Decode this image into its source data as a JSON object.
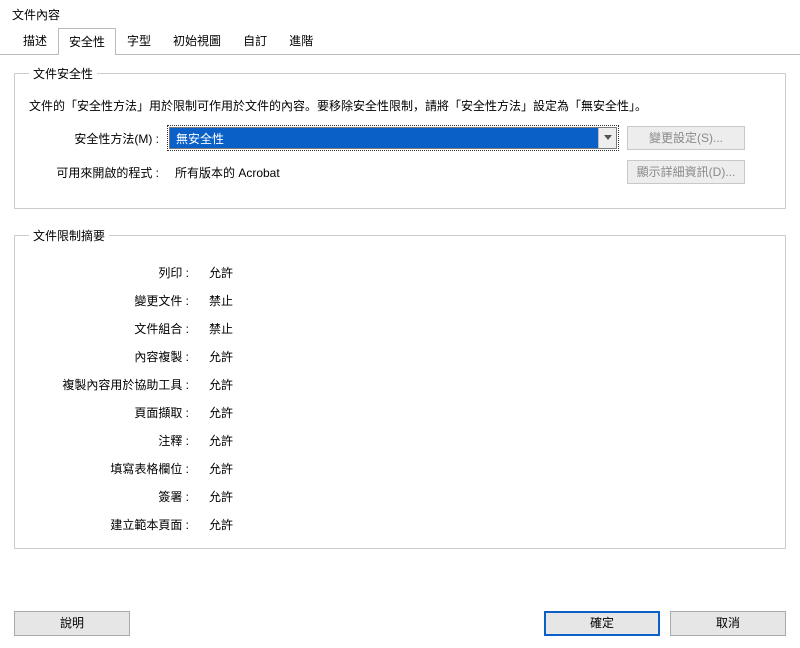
{
  "window": {
    "title": "文件內容"
  },
  "tabs": [
    {
      "label": "描述"
    },
    {
      "label": "安全性"
    },
    {
      "label": "字型"
    },
    {
      "label": "初始視圖"
    },
    {
      "label": "自訂"
    },
    {
      "label": "進階"
    }
  ],
  "activeTab": 1,
  "security": {
    "group_title": "文件安全性",
    "description": "文件的「安全性方法」用於限制可作用於文件的內容。要移除安全性限制，請將「安全性方法」設定為「無安全性」。",
    "method_label": "安全性方法(M) :",
    "method_value": "無安全性",
    "change_btn": "變更設定(S)...",
    "viewer_label": "可用來開啟的程式 :",
    "viewer_value": "所有版本的 Acrobat",
    "details_btn": "顯示詳細資訊(D)..."
  },
  "restrictions": {
    "group_title": "文件限制摘要",
    "items": [
      {
        "label": "列印",
        "value": "允許"
      },
      {
        "label": "變更文件",
        "value": "禁止"
      },
      {
        "label": "文件組合",
        "value": "禁止"
      },
      {
        "label": "內容複製",
        "value": "允許"
      },
      {
        "label": "複製內容用於協助工具",
        "value": "允許"
      },
      {
        "label": "頁面擷取",
        "value": "允許"
      },
      {
        "label": "注釋",
        "value": "允許"
      },
      {
        "label": "填寫表格欄位",
        "value": "允許"
      },
      {
        "label": "簽署",
        "value": "允許"
      },
      {
        "label": "建立範本頁面",
        "value": "允許"
      }
    ]
  },
  "footer": {
    "help": "說明",
    "ok": "確定",
    "cancel": "取消"
  }
}
